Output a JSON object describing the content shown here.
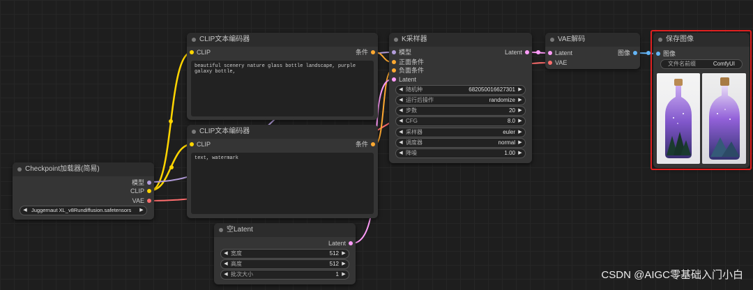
{
  "colors": {
    "clip": "#ffd500",
    "model": "#b39ddb",
    "vae": "#ff6e6e",
    "conditioning": "#ffa931",
    "latent": "#ff9cf9",
    "image": "#64b5f6",
    "highlight": "#e02020"
  },
  "checkpoint": {
    "title": "Checkpoint加载器(简易)",
    "out_model": "模型",
    "out_clip": "CLIP",
    "out_vae": "VAE",
    "ckpt_name": "Juggernaut XL_v8Rundiffusion.safetensors"
  },
  "clip_pos": {
    "title": "CLIP文本编码器",
    "in_clip": "CLIP",
    "out_cond": "条件",
    "text": "beautiful scenery nature glass bottle landscape, purple galaxy bottle,"
  },
  "clip_neg": {
    "title": "CLIP文本编码器",
    "in_clip": "CLIP",
    "out_cond": "条件",
    "text": "text, watermark"
  },
  "empty_latent": {
    "title": "空Latent",
    "out_latent": "Latent",
    "width_label": "宽度",
    "width_value": "512",
    "height_label": "高度",
    "height_value": "512",
    "batch_label": "批次大小",
    "batch_value": "1"
  },
  "ksampler": {
    "title": "K采样器",
    "in_model": "模型",
    "in_positive": "正面条件",
    "in_negative": "负面条件",
    "in_latent": "Latent",
    "out_latent": "Latent",
    "seed_label": "随机种",
    "seed_value": "682050016627301",
    "control_label": "运行后操作",
    "control_value": "randomize",
    "steps_label": "步数",
    "steps_value": "20",
    "cfg_label": "CFG",
    "cfg_value": "8.0",
    "sampler_label": "采样器",
    "sampler_value": "euler",
    "scheduler_label": "调度器",
    "scheduler_value": "normal",
    "denoise_label": "降噪",
    "denoise_value": "1.00"
  },
  "vae_decode": {
    "title": "VAE解码",
    "in_latent": "Latent",
    "in_vae": "VAE",
    "out_image": "图像"
  },
  "save_image": {
    "title": "保存图像",
    "in_image": "图像",
    "prefix_label": "文件名前缀",
    "prefix_value": "ComfyUI"
  },
  "widget_arrows": {
    "left": "◀",
    "right": "▶"
  },
  "watermark": "CSDN @AIGC零基础入门小白"
}
